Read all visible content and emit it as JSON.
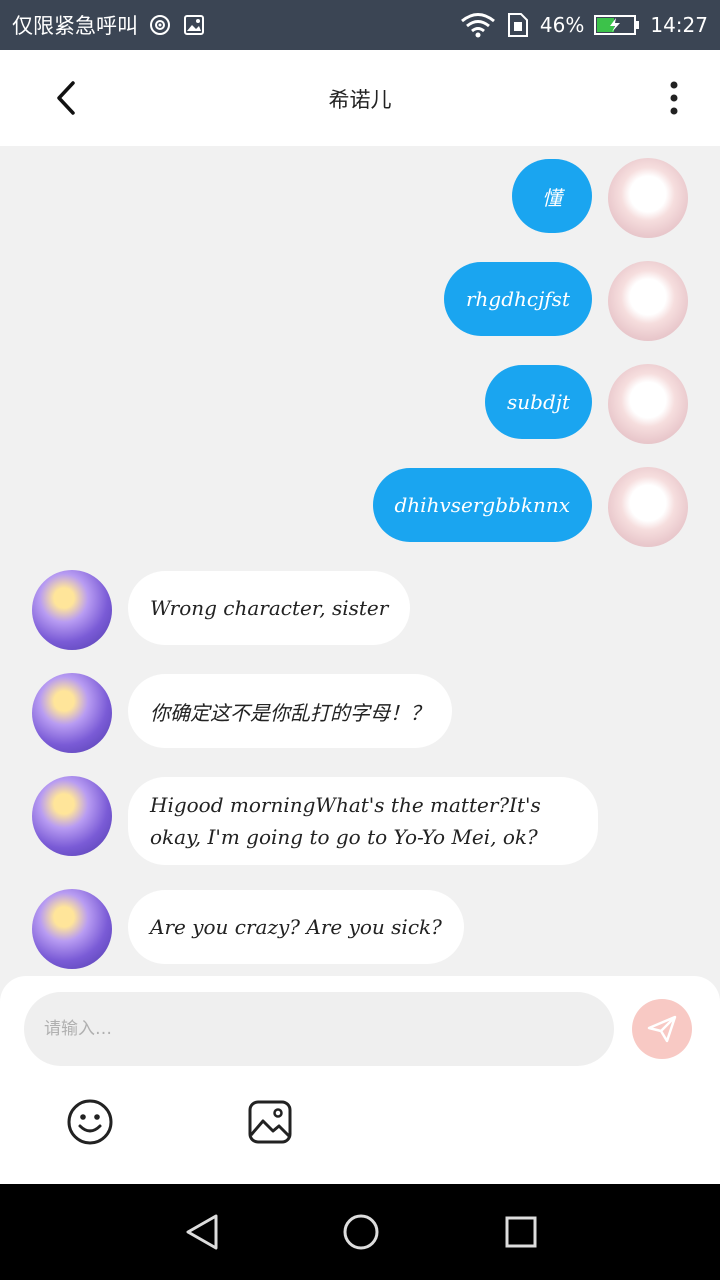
{
  "status_bar": {
    "carrier": "仅限紧急呼叫",
    "battery": "46%",
    "time": "14:27"
  },
  "header": {
    "title": "希诺儿"
  },
  "messages": [
    {
      "side": "out",
      "text": "懂"
    },
    {
      "side": "out",
      "text": "rhgdhcjfst"
    },
    {
      "side": "out",
      "text": "subdjt"
    },
    {
      "side": "out",
      "text": "dhihvsergbbknnx"
    },
    {
      "side": "in",
      "text": "Wrong character, sister"
    },
    {
      "side": "in",
      "text": "你确定这不是你乱打的字母！？"
    },
    {
      "side": "in",
      "text": "Higood morningWhat's the matter?It's okay, I'm going to go to Yo-Yo Mei, ok?"
    },
    {
      "side": "in",
      "text": "Are you crazy? Are you sick?"
    }
  ],
  "composer": {
    "placeholder": "请输入…"
  },
  "colors": {
    "outgoing_bubble": "#1aa5f0",
    "send_button": "#f8c9c4",
    "status_bar": "#3b4554"
  },
  "icons": {
    "back": "chevron-left-icon",
    "more": "more-vertical-icon",
    "send": "paper-plane-icon",
    "emoji": "smiley-icon",
    "image": "image-icon"
  }
}
